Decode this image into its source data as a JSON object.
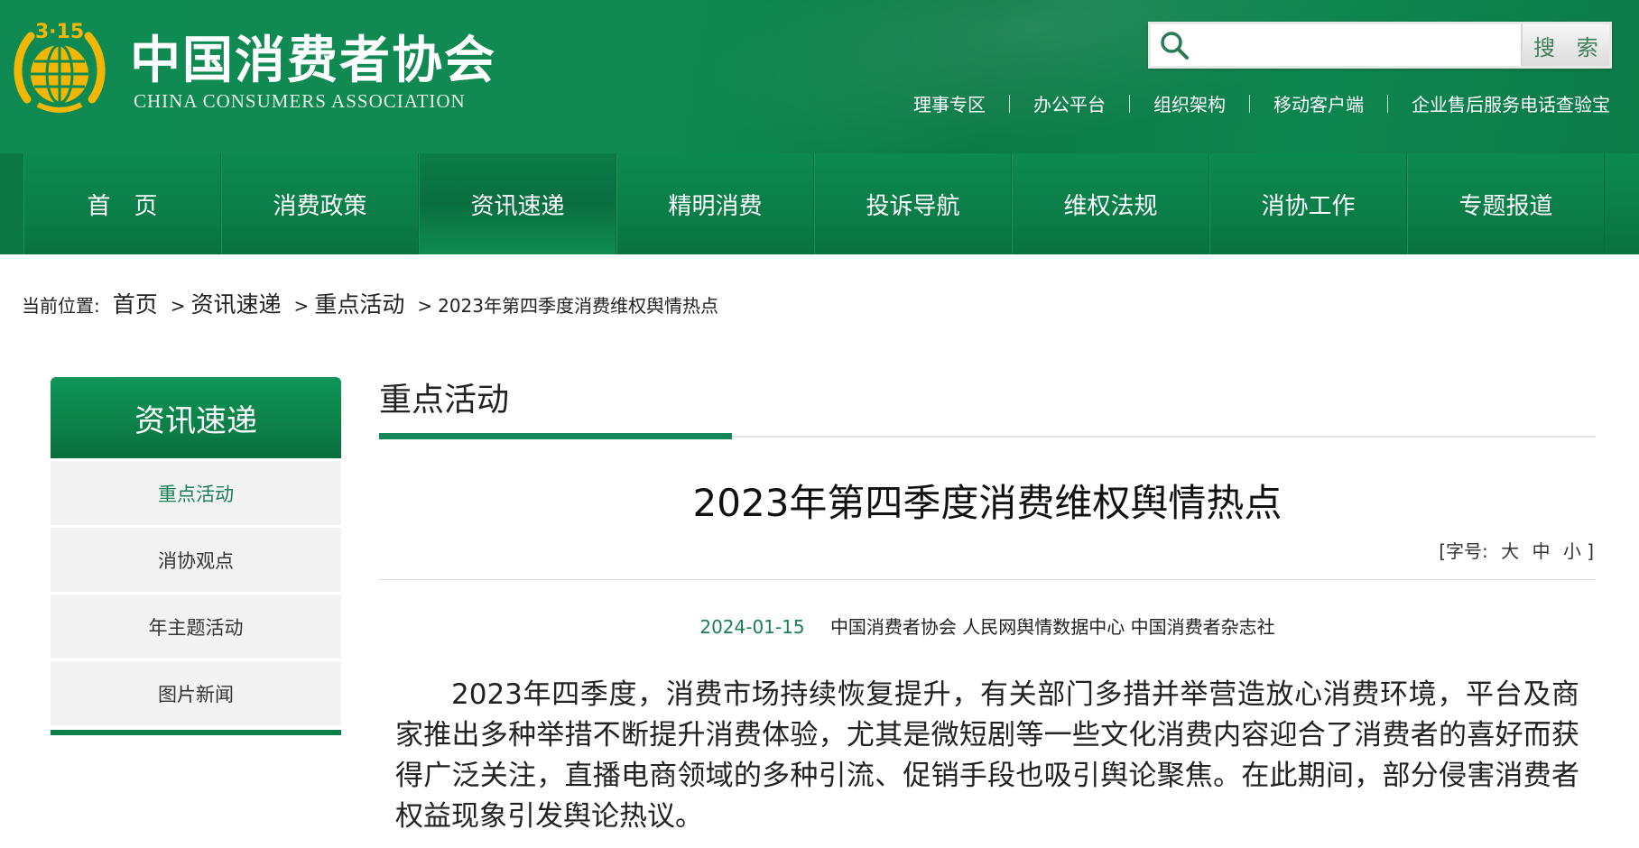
{
  "header": {
    "emblem_text": "3·15",
    "logo_cn": "中国消费者协会",
    "logo_en": "CHINA CONSUMERS ASSOCIATION",
    "search": {
      "placeholder": "",
      "button_label": "搜 索"
    },
    "top_links": [
      "理事专区",
      "办公平台",
      "组织架构",
      "移动客户端",
      "企业售后服务电话查验宝"
    ]
  },
  "nav": {
    "items": [
      "首　页",
      "消费政策",
      "资讯速递",
      "精明消费",
      "投诉导航",
      "维权法规",
      "消协工作",
      "专题报道"
    ],
    "active_index": 2
  },
  "breadcrumb": {
    "prefix": "当前位置:",
    "items": [
      "首页",
      "资讯速递",
      "重点活动"
    ],
    "separator": ">",
    "current": "2023年第四季度消费维权舆情热点"
  },
  "sidebar": {
    "title": "资讯速递",
    "items": [
      "重点活动",
      "消协观点",
      "年主题活动",
      "图片新闻"
    ],
    "active_index": 0
  },
  "main": {
    "section_title": "重点活动",
    "article": {
      "title": "2023年第四季度消费维权舆情热点",
      "font_size_control": {
        "open": "[字号:",
        "large": "大",
        "medium": "中",
        "small": "小",
        "close": "]"
      },
      "date": "2024-01-15",
      "source": "中国消费者协会 人民网舆情数据中心 中国消费者杂志社",
      "paragraph": "2023年四季度，消费市场持续恢复提升，有关部门多措并举营造放心消费环境，平台及商家推出多种举措不断提升消费体验，尤其是微短剧等一些文化消费内容迎合了消费者的喜好而获得广泛关注，直播电商领域的多种引流、促销手段也吸引舆论聚焦。在此期间，部分侵害消费者权益现象引发舆论热议。"
    }
  },
  "colors": {
    "brand_green": "#0b7846",
    "accent_green": "#13885a",
    "link_green": "#1b7f55",
    "emblem_gold": "#f2b705"
  }
}
